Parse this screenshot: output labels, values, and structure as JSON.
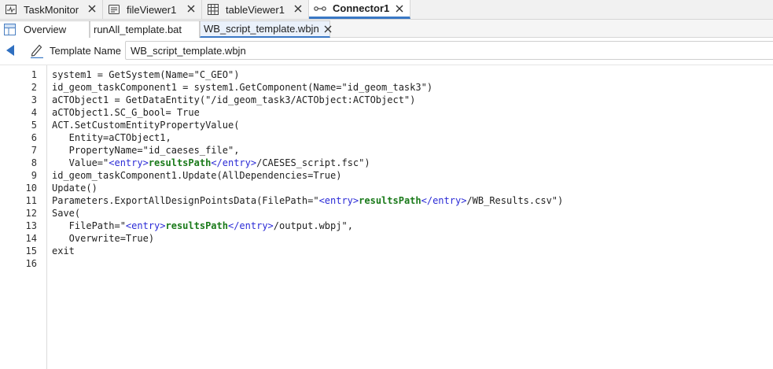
{
  "tabs": [
    {
      "label": "TaskMonitor",
      "icon": "task-monitor-icon"
    },
    {
      "label": "fileViewer1",
      "icon": "file-viewer-icon"
    },
    {
      "label": "tableViewer1",
      "icon": "table-icon"
    },
    {
      "label": "Connector1",
      "icon": "connector-icon",
      "active": true
    }
  ],
  "subtabs": [
    {
      "label": "Overview",
      "icon": "overview-grid-icon"
    },
    {
      "label": "runAll_template.bat"
    },
    {
      "label": "WB_script_template.wbjn",
      "active": true
    }
  ],
  "toolbar": {
    "template_name_label": "Template Name",
    "template_name_value": "WB_script_template.wbjn"
  },
  "editor": {
    "line_numbers": [
      "1",
      "2",
      "3",
      "4",
      "5",
      "6",
      "7",
      "8",
      "9",
      "10",
      "11",
      "12",
      "13",
      "14",
      "15",
      "16"
    ],
    "lines": [
      "system1 = GetSystem(Name=\"C_GEO\")",
      "id_geom_taskComponent1 = system1.GetComponent(Name=\"id_geom_task3\")",
      "aCTObject1 = GetDataEntity(\"/id_geom_task3/ACTObject:ACTObject\")",
      "aCTObject1.SC_G_bool= True",
      "ACT.SetCustomEntityPropertyValue(",
      "   Entity=aCTObject1,",
      "   PropertyName=\"id_caeses_file\",",
      {
        "pre": "   Value=\"",
        "tag_open": "<entry>",
        "entry": "resultsPath",
        "tag_close": "</entry>",
        "post": "/CAESES_script.fsc\")"
      },
      "id_geom_taskComponent1.Update(AllDependencies=True)",
      "Update()",
      {
        "pre": "Parameters.ExportAllDesignPointsData(FilePath=\"",
        "tag_open": "<entry>",
        "entry": "resultsPath",
        "tag_close": "</entry>",
        "post": "/WB_Results.csv\")"
      },
      "Save(",
      {
        "pre": "   FilePath=\"",
        "tag_open": "<entry>",
        "entry": "resultsPath",
        "tag_close": "</entry>",
        "post": "/output.wbpj\","
      },
      "   Overwrite=True)",
      "exit",
      ""
    ]
  }
}
